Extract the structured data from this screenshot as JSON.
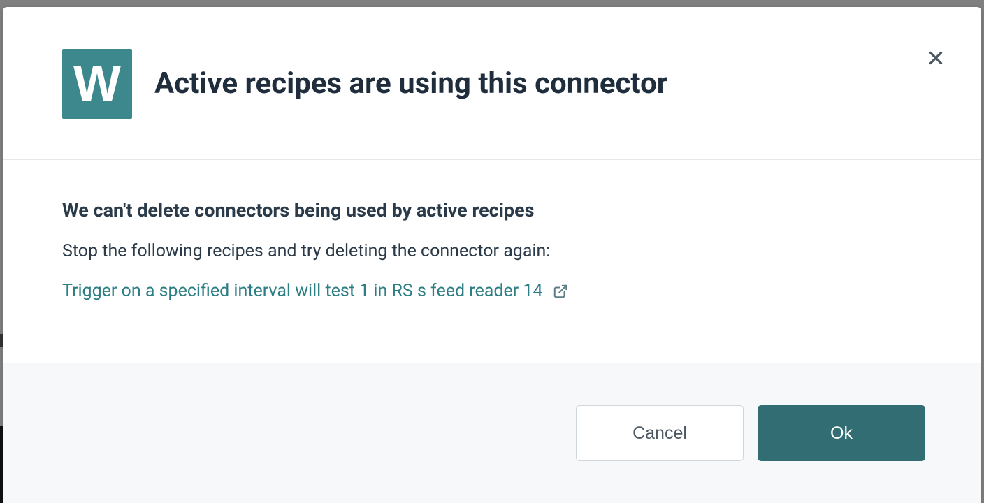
{
  "icon": {
    "letter": "W"
  },
  "dialog": {
    "title": "Active recipes are using this connector",
    "body_heading": "We can't delete connectors being used by active recipes",
    "instruction": "Stop the following recipes and try deleting the connector again:",
    "recipe_link_text": "Trigger on a specified interval will test 1 in RS s feed reader 14"
  },
  "footer": {
    "cancel_label": "Cancel",
    "ok_label": "Ok"
  }
}
